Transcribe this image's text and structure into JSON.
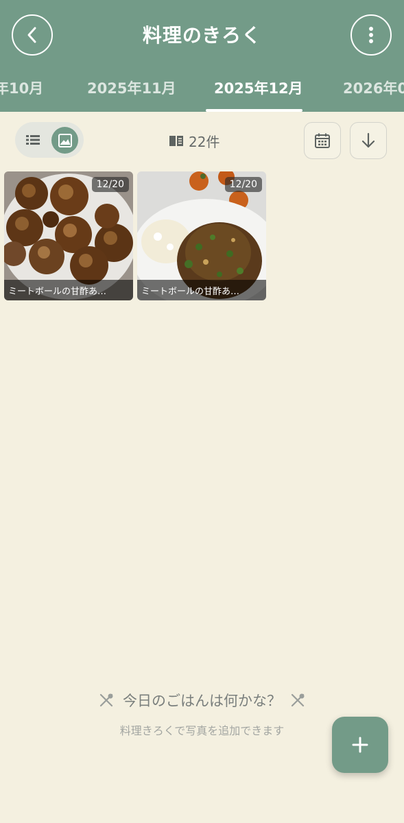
{
  "header": {
    "title": "料理のきろく",
    "back_icon": "chevron-left-icon",
    "more_icon": "more-vertical-icon",
    "background_color": "#739b88"
  },
  "tabs": [
    {
      "label": "年10月",
      "active": false
    },
    {
      "label": "2025年11月",
      "active": false
    },
    {
      "label": "2025年12月",
      "active": true
    },
    {
      "label": "2026年0",
      "active": false
    }
  ],
  "toolbar": {
    "view_modes": [
      "list",
      "grid"
    ],
    "selected_view": "grid",
    "count_label": "22件",
    "calendar_icon": "calendar-icon",
    "sort_icon": "arrow-down-icon"
  },
  "entries": [
    {
      "date": "12/20",
      "title": "ミートボールの甘酢あ…"
    },
    {
      "date": "12/20",
      "title": "ミートボールの甘酢あ…"
    }
  ],
  "empty_state": {
    "title": "今日のごはんは何かな？",
    "subtitle": "料理きろくで写真を追加できます",
    "icon": "fork-knife-icon"
  },
  "fab": {
    "icon": "plus-icon"
  }
}
